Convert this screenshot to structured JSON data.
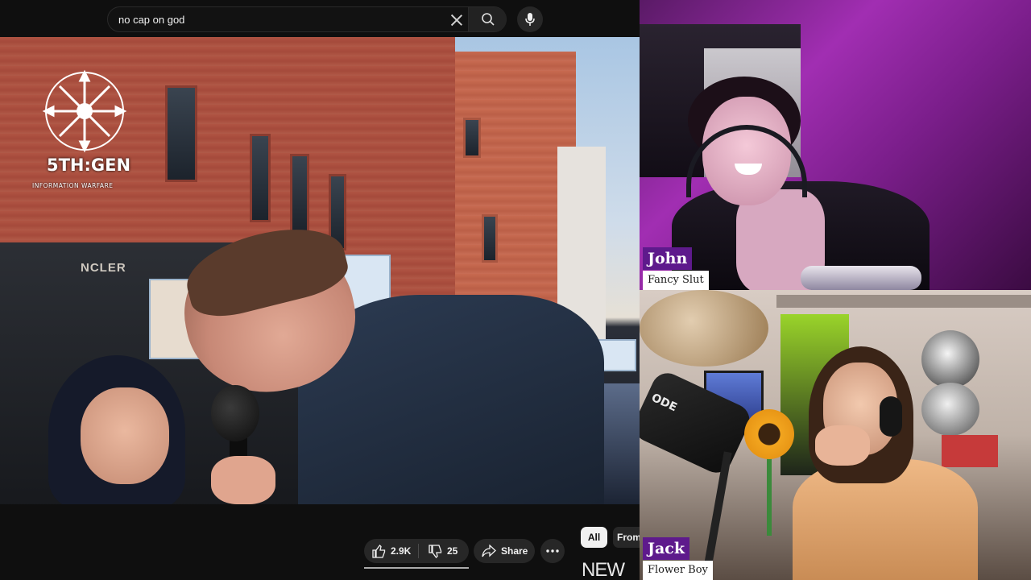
{
  "youtube": {
    "search": {
      "value": "no cap on god",
      "placeholder": "Search"
    },
    "channel_logo": {
      "title": "5TH:GEN",
      "subtitle": "INFORMATION WARFARE"
    },
    "video_scene": {
      "store_sign": "NCLER"
    },
    "actions": {
      "like_count": "2.9K",
      "dislike_count": "25",
      "share_label": "Share"
    },
    "filter_chips": [
      "All",
      "From"
    ],
    "suggested_fragment": "NEW"
  },
  "streams": [
    {
      "name": "John",
      "subtitle": "Fancy Slut"
    },
    {
      "name": "Jack",
      "subtitle": "Flower Boy"
    }
  ],
  "colors": {
    "nameplate_bg": "#5e1a8c",
    "nameplate_sub_bg": "#ffffff",
    "youtube_bg": "#0f0f0f",
    "pill_bg": "#272727"
  },
  "icons": [
    "clear-icon",
    "search-icon",
    "mic-icon",
    "thumbs-up-icon",
    "thumbs-down-icon",
    "share-icon",
    "more-icon"
  ]
}
